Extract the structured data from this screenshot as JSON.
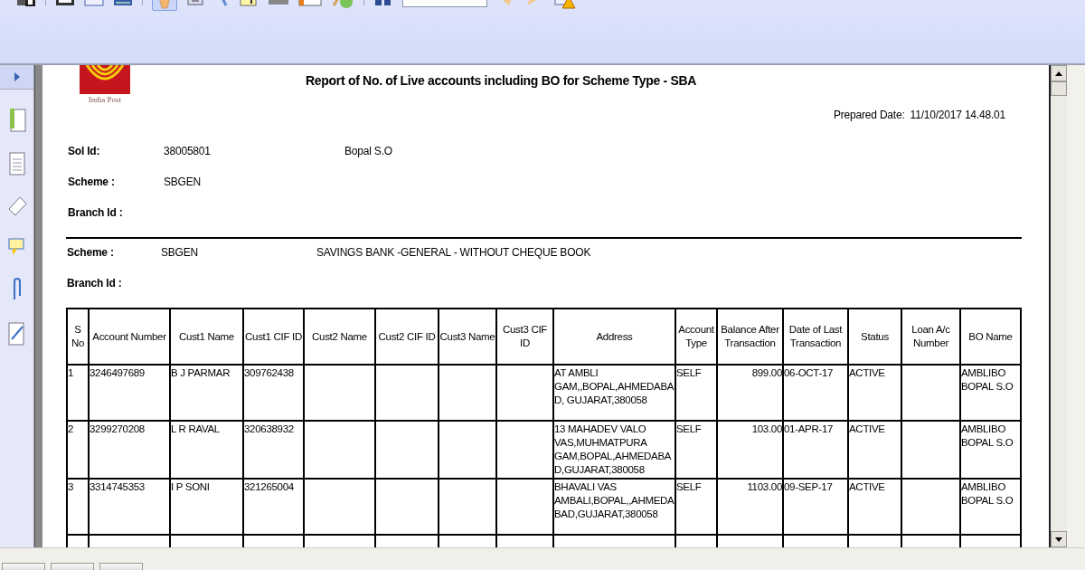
{
  "report": {
    "logo_caption": "India Post",
    "title": "Report of No. of Live accounts including BO for Scheme Type - SBA",
    "prepared_label": "Prepared Date:",
    "prepared_value": "11/10/2017 14.48.01",
    "header_fields": [
      {
        "label": "Sol Id:",
        "value": "38005801",
        "extra": "Bopal S.O"
      },
      {
        "label": "Scheme :",
        "value": "SBGEN"
      },
      {
        "label": "Branch Id :"
      }
    ],
    "group_fields": [
      {
        "label": "Scheme :",
        "value": "SBGEN",
        "extra": "SAVINGS BANK -GENERAL - WITHOUT CHEQUE BOOK"
      },
      {
        "label": "Branch Id :"
      }
    ],
    "table": {
      "columns": [
        "S No",
        "Account Number",
        "Cust1 Name",
        "Cust1 CIF ID",
        "Cust2 Name",
        "Cust2 CIF ID",
        "Cust3 Name",
        "Cust3 CIF ID",
        "Address",
        "Account Type",
        "Balance After Transaction",
        "Date of Last Transaction",
        "Status",
        "Loan A/c Number",
        "BO Name"
      ],
      "rows": [
        [
          "1",
          "3246497689",
          "B J PARMAR",
          "309762438",
          null,
          null,
          null,
          null,
          "AT AMBLI GAM,,BOPAL,AHMEDABAD, GUJARAT,380058",
          "SELF",
          "899.00",
          "06-OCT-17",
          "ACTIVE",
          null,
          "AMBLIBO BOPAL S.O"
        ],
        [
          "2",
          "3299270208",
          "L R RAVAL",
          "320638932",
          null,
          null,
          null,
          null,
          "13 MAHADEV VALO VAS,MUHMATPURA GAM,BOPAL,AHMEDABAD,GUJARAT,380058",
          "SELF",
          "103.00",
          "01-APR-17",
          "ACTIVE",
          null,
          "AMBLIBO BOPAL S.O"
        ],
        [
          "3",
          "3314745353",
          "I P SONI",
          "321265004",
          null,
          null,
          null,
          null,
          "BHAVALI VAS AMBALI,BOPAL,,AHMEDABAD,GUJARAT,380058",
          "SELF",
          "1103.00",
          "09-SEP-17",
          "ACTIVE",
          null,
          "AMBLIBO BOPAL S.O"
        ]
      ]
    }
  }
}
